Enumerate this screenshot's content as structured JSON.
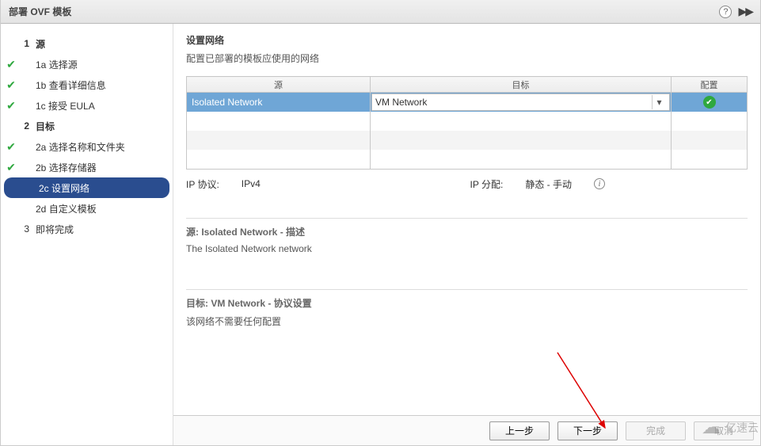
{
  "window": {
    "title": "部署 OVF 模板"
  },
  "sidebar": {
    "steps": {
      "s1": {
        "num": "1",
        "label": "源"
      },
      "s1a": {
        "num": "1a",
        "label": "选择源"
      },
      "s1b": {
        "num": "1b",
        "label": "查看详细信息"
      },
      "s1c": {
        "num": "1c",
        "label": "接受 EULA"
      },
      "s2": {
        "num": "2",
        "label": "目标"
      },
      "s2a": {
        "num": "2a",
        "label": "选择名称和文件夹"
      },
      "s2b": {
        "num": "2b",
        "label": "选择存储器"
      },
      "s2c": {
        "num": "2c",
        "label": "设置网络"
      },
      "s2d": {
        "num": "2d",
        "label": "自定义模板"
      },
      "s3": {
        "num": "3",
        "label": "即将完成"
      }
    }
  },
  "content": {
    "heading": "设置网络",
    "subtitle": "配置已部署的模板应使用的网络",
    "table": {
      "headers": {
        "source": "源",
        "dest": "目标",
        "config": "配置"
      },
      "row": {
        "source": "Isolated Network",
        "dest_selected": "VM Network"
      }
    },
    "ip": {
      "protocol_label": "IP 协议:",
      "protocol_value": "IPv4",
      "alloc_label": "IP 分配:",
      "alloc_value": "静态 - 手动"
    },
    "section1": {
      "title": "源: Isolated Network - 描述",
      "body": "The Isolated Network network"
    },
    "section2": {
      "title": "目标: VM Network - 协议设置",
      "body": "该网络不需要任何配置"
    }
  },
  "footer": {
    "back": "上一步",
    "next": "下一步",
    "finish": "完成",
    "cancel": "取消"
  },
  "watermark": "亿速云"
}
